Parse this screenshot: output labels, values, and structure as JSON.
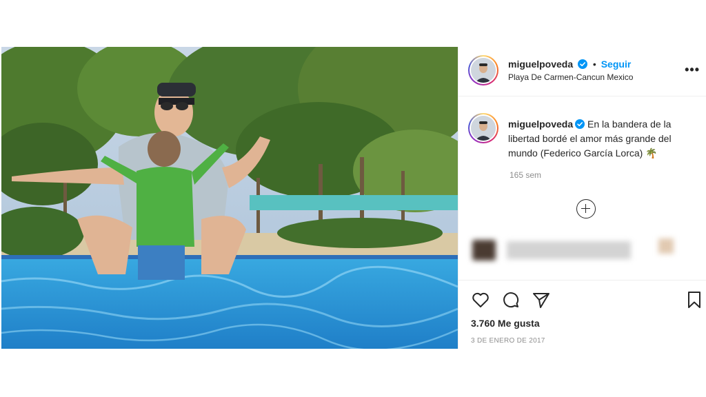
{
  "post": {
    "username": "miguelpoveda",
    "verified": true,
    "follow_label": "Seguir",
    "separator": "•",
    "location": "Playa De Carmen-Cancun Mexico",
    "more_label": "•••",
    "caption_username": "miguelpoveda",
    "caption_text": "En la bandera de la libertad bordé el amor más grande del mundo (Federico García Lorca) 🌴",
    "time_ago": "165 sem",
    "likes": "3.760 Me gusta",
    "date": "3 DE ENERO DE 2017"
  },
  "icons": {
    "verified": "verified-badge-icon",
    "like": "heart-icon",
    "comment": "comment-bubble-icon",
    "share": "paper-plane-icon",
    "save": "bookmark-icon",
    "load_more": "plus-circle-icon",
    "more": "more-options-icon"
  },
  "colors": {
    "accent": "#0095f6",
    "text": "#262626",
    "muted": "#8e8e8e",
    "divider": "#efefef"
  }
}
